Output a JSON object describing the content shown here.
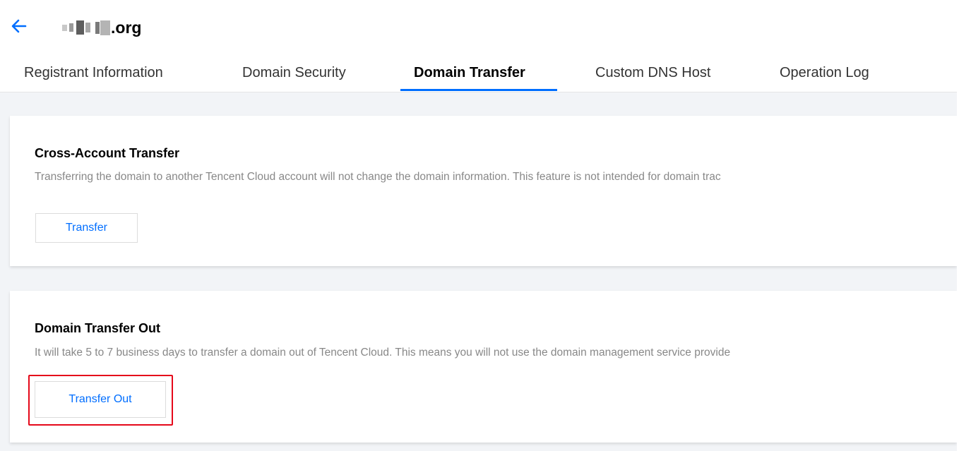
{
  "header": {
    "back_icon": "arrow-left-icon",
    "domain_suffix": ".org",
    "accent_color": "#006eff"
  },
  "tabs": [
    {
      "label": "Registrant Information",
      "active": false
    },
    {
      "label": "Domain Security",
      "active": false
    },
    {
      "label": "Domain Transfer",
      "active": true
    },
    {
      "label": "Custom DNS Host",
      "active": false
    },
    {
      "label": "Operation Log",
      "active": false
    }
  ],
  "cross_account": {
    "title": "Cross-Account Transfer",
    "description": "Transferring the domain to another Tencent Cloud account will not change the domain information. This feature is not intended for domain trac",
    "button_label": "Transfer"
  },
  "transfer_out": {
    "title": "Domain Transfer Out",
    "description": "It will take 5 to 7 business days to transfer a domain out of Tencent Cloud. This means you will not use the domain management service provide",
    "button_label": "Transfer Out",
    "highlight_color": "#e5081a"
  }
}
